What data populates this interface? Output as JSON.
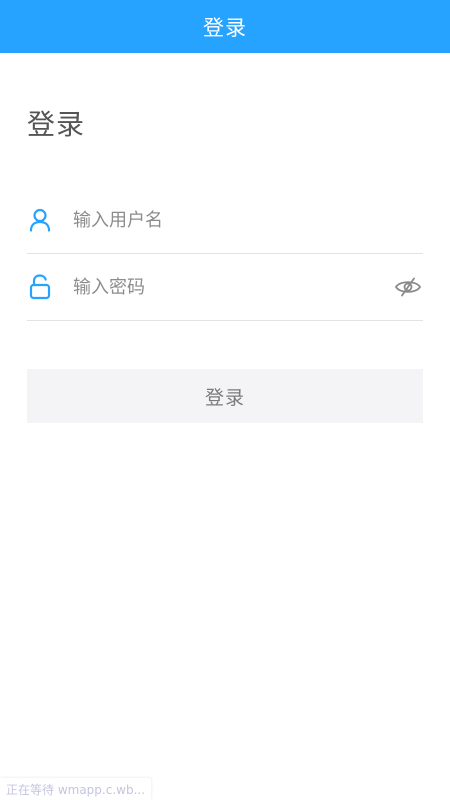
{
  "header": {
    "title": "登录"
  },
  "main": {
    "heading": "登录",
    "username": {
      "placeholder": "输入用户名",
      "value": "",
      "icon": "user-icon"
    },
    "password": {
      "placeholder": "输入密码",
      "value": "",
      "icon": "unlock-icon",
      "toggle_icon": "eye-slash-icon"
    },
    "login_button": "登录"
  },
  "status_bar": {
    "text": "正在等待 wmapp.c.wb..."
  },
  "colors": {
    "header_bg": "#26a2ff",
    "icon": "#26a2ff",
    "button_bg": "#f4f4f6"
  }
}
